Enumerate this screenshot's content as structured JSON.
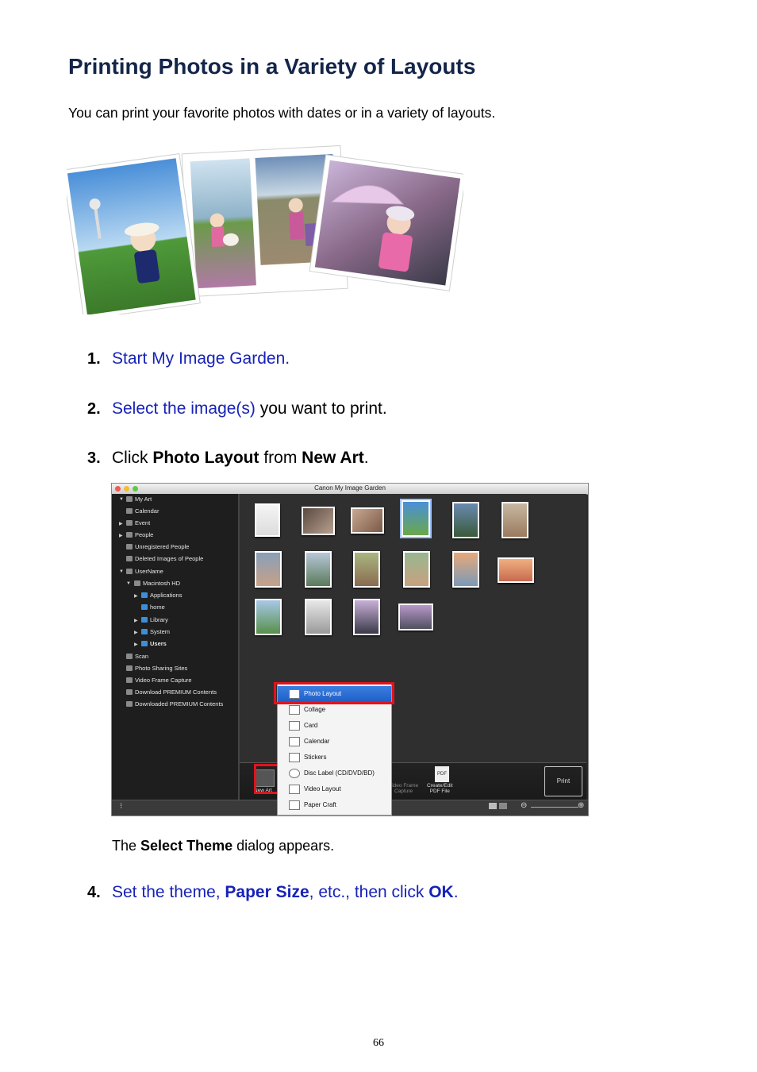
{
  "title": "Printing Photos in a Variety of Layouts",
  "intro": "You can print your favorite photos with dates or in a variety of layouts.",
  "steps": [
    {
      "num": "1.",
      "link": "Start My Image Garden."
    },
    {
      "num": "2.",
      "link": "Select the image(s)",
      "rest": " you want to print."
    },
    {
      "num": "3.",
      "pre": "Click ",
      "bold1": "Photo Layout",
      "mid": " from ",
      "bold2": "New Art",
      "post": "."
    },
    {
      "num": "4.",
      "pre": "Set the theme, ",
      "bold1": "Paper Size",
      "mid": ", etc., then click ",
      "bold2": "OK",
      "post": "."
    }
  ],
  "note": {
    "pre": "The ",
    "bold": "Select Theme",
    "post": " dialog appears."
  },
  "page_number": "66",
  "app": {
    "window_title": "Canon My Image Garden",
    "sidebar": [
      "My Art",
      "Calendar",
      "Event",
      "People",
      "Unregistered People",
      "Deleted Images of People",
      "UserName",
      "Macintosh HD",
      "Applications",
      "home",
      "Library",
      "System",
      "Users",
      "Scan",
      "Photo Sharing Sites",
      "Video Frame Capture",
      "Download PREMIUM Contents",
      "Downloaded PREMIUM Contents"
    ],
    "menu": [
      "Photo Layout",
      "Collage",
      "Card",
      "Calendar",
      "Stickers",
      "Disc Label (CD/DVD/BD)",
      "Video Layout",
      "Paper Craft"
    ],
    "toolbar": {
      "new_art": "New Art",
      "video_frame_line1": "Video Frame",
      "video_frame_line2": "Capture",
      "pdf_line1": "Create/Edit",
      "pdf_line2": "PDF File",
      "print": "Print"
    }
  },
  "colors": {
    "heading": "#14254a",
    "link": "#1722b8",
    "highlight": "#e0141e",
    "menu_selected": "#2a6fd6"
  }
}
